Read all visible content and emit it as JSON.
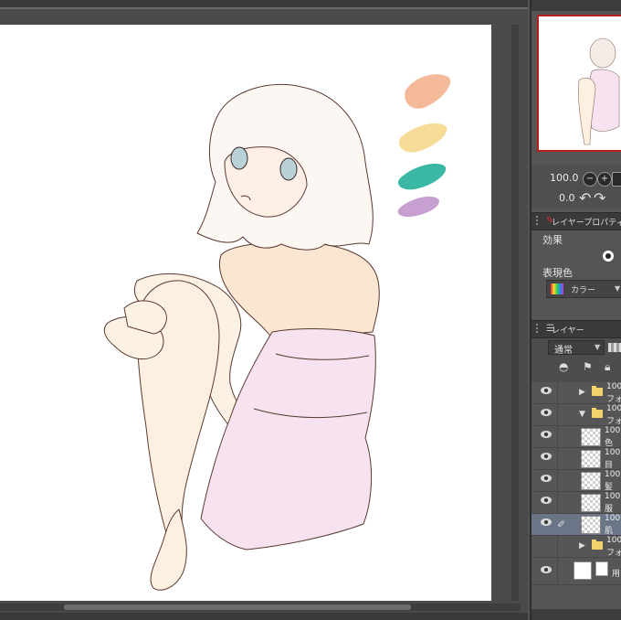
{
  "palette": {
    "colors": [
      "#f4b999",
      "#f7dc97",
      "#3ab8a4",
      "#c89fd1"
    ],
    "names": [
      "peach-swatch",
      "yellow-swatch",
      "teal-swatch",
      "lavender-swatch"
    ]
  },
  "navigator": {
    "zoom_value": "100.0",
    "angle_value": "0.0"
  },
  "layer_property_panel": {
    "tab_label": "レイヤープロパティ",
    "effect_label": "効果",
    "expression_color_label": "表現色",
    "expression_color_value": "カラー"
  },
  "layer_panel": {
    "tab_label": "レイヤー",
    "blend_mode": "通常",
    "layers": [
      {
        "opacity": "100",
        "name": "フォ",
        "type": "folder",
        "expanded": false
      },
      {
        "opacity": "100",
        "name": "フォ",
        "type": "folder",
        "expanded": true
      },
      {
        "opacity": "100",
        "name": "色",
        "type": "raster"
      },
      {
        "opacity": "100",
        "name": "目",
        "type": "raster"
      },
      {
        "opacity": "100",
        "name": "髪",
        "type": "raster"
      },
      {
        "opacity": "100",
        "name": "服",
        "type": "raster"
      },
      {
        "opacity": "100",
        "name": "肌",
        "type": "raster",
        "selected": true
      },
      {
        "opacity": "100",
        "name": "フォ",
        "type": "folder",
        "expanded": false
      },
      {
        "opacity": "",
        "name": "用",
        "type": "paper"
      }
    ]
  },
  "colors": {
    "selected_row": "#6a7688",
    "navigator_frame": "#b51e1e",
    "folder": "#f1d46a"
  }
}
